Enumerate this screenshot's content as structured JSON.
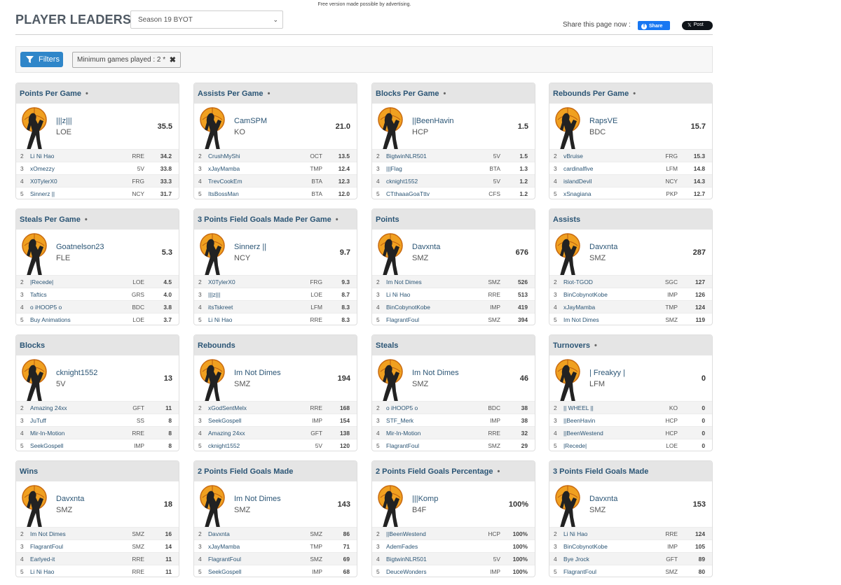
{
  "ad_note": "Free version made possible by advertising.",
  "header": {
    "title": "PLAYER LEADERS",
    "season_selected": "Season 19 BYOT",
    "share_label": "Share this page now :",
    "fb_label": "Share",
    "x_label": "Post"
  },
  "filters": {
    "button_label": "Filters",
    "chip_label": "Minimum games played : 2  *",
    "chip_close": "✖"
  },
  "colors": {
    "accent": "#2f86c9",
    "link": "#2b5575",
    "header_bg": "#e5e5e5",
    "facebook": "#1877f2"
  },
  "cards": [
    {
      "title": "Points Per Game",
      "dot": "•",
      "leader": {
        "name": "|||z|||",
        "team": "LOE",
        "value": "35.5"
      },
      "rows": [
        {
          "rank": "2",
          "name": "Li Ni Hao",
          "team": "RRE",
          "value": "34.2"
        },
        {
          "rank": "3",
          "name": "xOmezzy",
          "team": "5V",
          "value": "33.8"
        },
        {
          "rank": "4",
          "name": "X0TylerX0",
          "team": "FRG",
          "value": "33.3"
        },
        {
          "rank": "5",
          "name": "Sinnerz ||",
          "team": "NCY",
          "value": "31.7"
        }
      ]
    },
    {
      "title": "Assists Per Game",
      "dot": "•",
      "leader": {
        "name": "CamSPM",
        "team": "KO",
        "value": "21.0"
      },
      "rows": [
        {
          "rank": "2",
          "name": "CrushMyShi",
          "team": "OCT",
          "value": "13.5"
        },
        {
          "rank": "3",
          "name": "xJayMamba",
          "team": "TMP",
          "value": "12.4"
        },
        {
          "rank": "4",
          "name": "TrevCookEm",
          "team": "BTA",
          "value": "12.3"
        },
        {
          "rank": "5",
          "name": "ItsBossMan",
          "team": "BTA",
          "value": "12.0"
        }
      ]
    },
    {
      "title": "Blocks Per Game",
      "dot": "•",
      "leader": {
        "name": "||BeenHavin",
        "team": "HCP",
        "value": "1.5"
      },
      "rows": [
        {
          "rank": "2",
          "name": "BigtwinNLR501",
          "team": "5V",
          "value": "1.5"
        },
        {
          "rank": "3",
          "name": "|||Flag",
          "team": "BTA",
          "value": "1.3"
        },
        {
          "rank": "4",
          "name": "cknight1552",
          "team": "5V",
          "value": "1.2"
        },
        {
          "rank": "5",
          "name": "CTthaaaGoaTttv",
          "team": "CFS",
          "value": "1.2"
        }
      ]
    },
    {
      "title": "Rebounds Per Game",
      "dot": "•",
      "leader": {
        "name": "RapsVE",
        "team": "BDC",
        "value": "15.7"
      },
      "rows": [
        {
          "rank": "2",
          "name": "vBruise",
          "team": "FRG",
          "value": "15.3"
        },
        {
          "rank": "3",
          "name": "cardinalfive",
          "team": "LFM",
          "value": "14.8"
        },
        {
          "rank": "4",
          "name": "islandDevil",
          "team": "NCY",
          "value": "14.3"
        },
        {
          "rank": "5",
          "name": "xSnagiana",
          "team": "PKP",
          "value": "12.7"
        }
      ]
    },
    {
      "title": "Steals Per Game",
      "dot": "•",
      "leader": {
        "name": "Goatnelson23",
        "team": "FLE",
        "value": "5.3"
      },
      "rows": [
        {
          "rank": "2",
          "name": "|Recede|",
          "team": "LOE",
          "value": "4.5"
        },
        {
          "rank": "3",
          "name": "Taftics",
          "team": "GRS",
          "value": "4.0"
        },
        {
          "rank": "4",
          "name": "o iHOOP5 o",
          "team": "BDC",
          "value": "3.8"
        },
        {
          "rank": "5",
          "name": "Buy Animations",
          "team": "LOE",
          "value": "3.7"
        }
      ]
    },
    {
      "title": "3 Points Field Goals Made Per Game",
      "dot": "•",
      "leader": {
        "name": "Sinnerz ||",
        "team": "NCY",
        "value": "9.7"
      },
      "rows": [
        {
          "rank": "2",
          "name": "X0TylerX0",
          "team": "FRG",
          "value": "9.3"
        },
        {
          "rank": "3",
          "name": "|||z|||",
          "team": "LOE",
          "value": "8.7"
        },
        {
          "rank": "4",
          "name": "itsTskreet",
          "team": "LFM",
          "value": "8.3"
        },
        {
          "rank": "5",
          "name": "Li Ni Hao",
          "team": "RRE",
          "value": "8.3"
        }
      ]
    },
    {
      "title": "Points",
      "dot": "",
      "leader": {
        "name": "Davxnta",
        "team": "SMZ",
        "value": "676"
      },
      "rows": [
        {
          "rank": "2",
          "name": "Im Not Dimes",
          "team": "SMZ",
          "value": "526"
        },
        {
          "rank": "3",
          "name": "Li Ni Hao",
          "team": "RRE",
          "value": "513"
        },
        {
          "rank": "4",
          "name": "BinCobynotKobe",
          "team": "IMP",
          "value": "419"
        },
        {
          "rank": "5",
          "name": "FlagrantFoul",
          "team": "SMZ",
          "value": "394"
        }
      ]
    },
    {
      "title": "Assists",
      "dot": "",
      "leader": {
        "name": "Davxnta",
        "team": "SMZ",
        "value": "287"
      },
      "rows": [
        {
          "rank": "2",
          "name": "Riot-TGOD",
          "team": "SGC",
          "value": "127"
        },
        {
          "rank": "3",
          "name": "BinCobynotKobe",
          "team": "IMP",
          "value": "126"
        },
        {
          "rank": "4",
          "name": "xJayMamba",
          "team": "TMP",
          "value": "124"
        },
        {
          "rank": "5",
          "name": "Im Not Dimes",
          "team": "SMZ",
          "value": "119"
        }
      ]
    },
    {
      "title": "Blocks",
      "dot": "",
      "leader": {
        "name": "cknight1552",
        "team": "5V",
        "value": "13"
      },
      "rows": [
        {
          "rank": "2",
          "name": "Amazing 24xx",
          "team": "GFT",
          "value": "11"
        },
        {
          "rank": "3",
          "name": "JuTuff",
          "team": "SS",
          "value": "8"
        },
        {
          "rank": "4",
          "name": "Mir-In-Motion",
          "team": "RRE",
          "value": "8"
        },
        {
          "rank": "5",
          "name": "SeekGospell",
          "team": "IMP",
          "value": "8"
        }
      ]
    },
    {
      "title": "Rebounds",
      "dot": "",
      "leader": {
        "name": "Im Not Dimes",
        "team": "SMZ",
        "value": "194"
      },
      "rows": [
        {
          "rank": "2",
          "name": "xGodSentMelx",
          "team": "RRE",
          "value": "168"
        },
        {
          "rank": "3",
          "name": "SeekGospell",
          "team": "IMP",
          "value": "154"
        },
        {
          "rank": "4",
          "name": "Amazing 24xx",
          "team": "GFT",
          "value": "138"
        },
        {
          "rank": "5",
          "name": "cknight1552",
          "team": "5V",
          "value": "120"
        }
      ]
    },
    {
      "title": "Steals",
      "dot": "",
      "leader": {
        "name": "Im Not Dimes",
        "team": "SMZ",
        "value": "46"
      },
      "rows": [
        {
          "rank": "2",
          "name": "o iHOOP5 o",
          "team": "BDC",
          "value": "38"
        },
        {
          "rank": "3",
          "name": "STF_Merk",
          "team": "IMP",
          "value": "38"
        },
        {
          "rank": "4",
          "name": "Mir-In-Motion",
          "team": "RRE",
          "value": "32"
        },
        {
          "rank": "5",
          "name": "FlagrantFoul",
          "team": "SMZ",
          "value": "29"
        }
      ]
    },
    {
      "title": "Turnovers",
      "dot": "•",
      "leader": {
        "name": "| Freakyy |",
        "team": "LFM",
        "value": "0"
      },
      "rows": [
        {
          "rank": "2",
          "name": "|| WHEEL ||",
          "team": "KO",
          "value": "0"
        },
        {
          "rank": "3",
          "name": "||BeenHavin",
          "team": "HCP",
          "value": "0"
        },
        {
          "rank": "4",
          "name": "||BeenWestend",
          "team": "HCP",
          "value": "0"
        },
        {
          "rank": "5",
          "name": "|Recede|",
          "team": "LOE",
          "value": "0"
        }
      ]
    },
    {
      "title": "Wins",
      "dot": "",
      "leader": {
        "name": "Davxnta",
        "team": "SMZ",
        "value": "18"
      },
      "rows": [
        {
          "rank": "2",
          "name": "Im Not Dimes",
          "team": "SMZ",
          "value": "16"
        },
        {
          "rank": "3",
          "name": "FlagrantFoul",
          "team": "SMZ",
          "value": "14"
        },
        {
          "rank": "4",
          "name": "Earlyed-it",
          "team": "RRE",
          "value": "11"
        },
        {
          "rank": "5",
          "name": "Li Ni Hao",
          "team": "RRE",
          "value": "11"
        }
      ]
    },
    {
      "title": "2 Points Field Goals Made",
      "dot": "",
      "leader": {
        "name": "Im Not Dimes",
        "team": "SMZ",
        "value": "143"
      },
      "rows": [
        {
          "rank": "2",
          "name": "Davxnta",
          "team": "SMZ",
          "value": "86"
        },
        {
          "rank": "3",
          "name": "xJayMamba",
          "team": "TMP",
          "value": "71"
        },
        {
          "rank": "4",
          "name": "FlagrantFoul",
          "team": "SMZ",
          "value": "69"
        },
        {
          "rank": "5",
          "name": "SeekGospell",
          "team": "IMP",
          "value": "68"
        }
      ]
    },
    {
      "title": "2 Points Field Goals Percentage",
      "dot": "•",
      "leader": {
        "name": "|||Komp",
        "team": "B4F",
        "value": "100%"
      },
      "rows": [
        {
          "rank": "2",
          "name": "||BeenWestend",
          "team": "HCP",
          "value": "100%"
        },
        {
          "rank": "3",
          "name": "AdemFades",
          "team": "",
          "value": "100%"
        },
        {
          "rank": "4",
          "name": "BigtwinNLR501",
          "team": "5V",
          "value": "100%"
        },
        {
          "rank": "5",
          "name": "DeuceWonders",
          "team": "IMP",
          "value": "100%"
        }
      ]
    },
    {
      "title": "3 Points Field Goals Made",
      "dot": "",
      "leader": {
        "name": "Davxnta",
        "team": "SMZ",
        "value": "153"
      },
      "rows": [
        {
          "rank": "2",
          "name": "Li Ni Hao",
          "team": "RRE",
          "value": "124"
        },
        {
          "rank": "3",
          "name": "BinCobynotKobe",
          "team": "IMP",
          "value": "105"
        },
        {
          "rank": "4",
          "name": "Bye Jrock",
          "team": "GFT",
          "value": "89"
        },
        {
          "rank": "5",
          "name": "FlagrantFoul",
          "team": "SMZ",
          "value": "80"
        }
      ]
    }
  ]
}
